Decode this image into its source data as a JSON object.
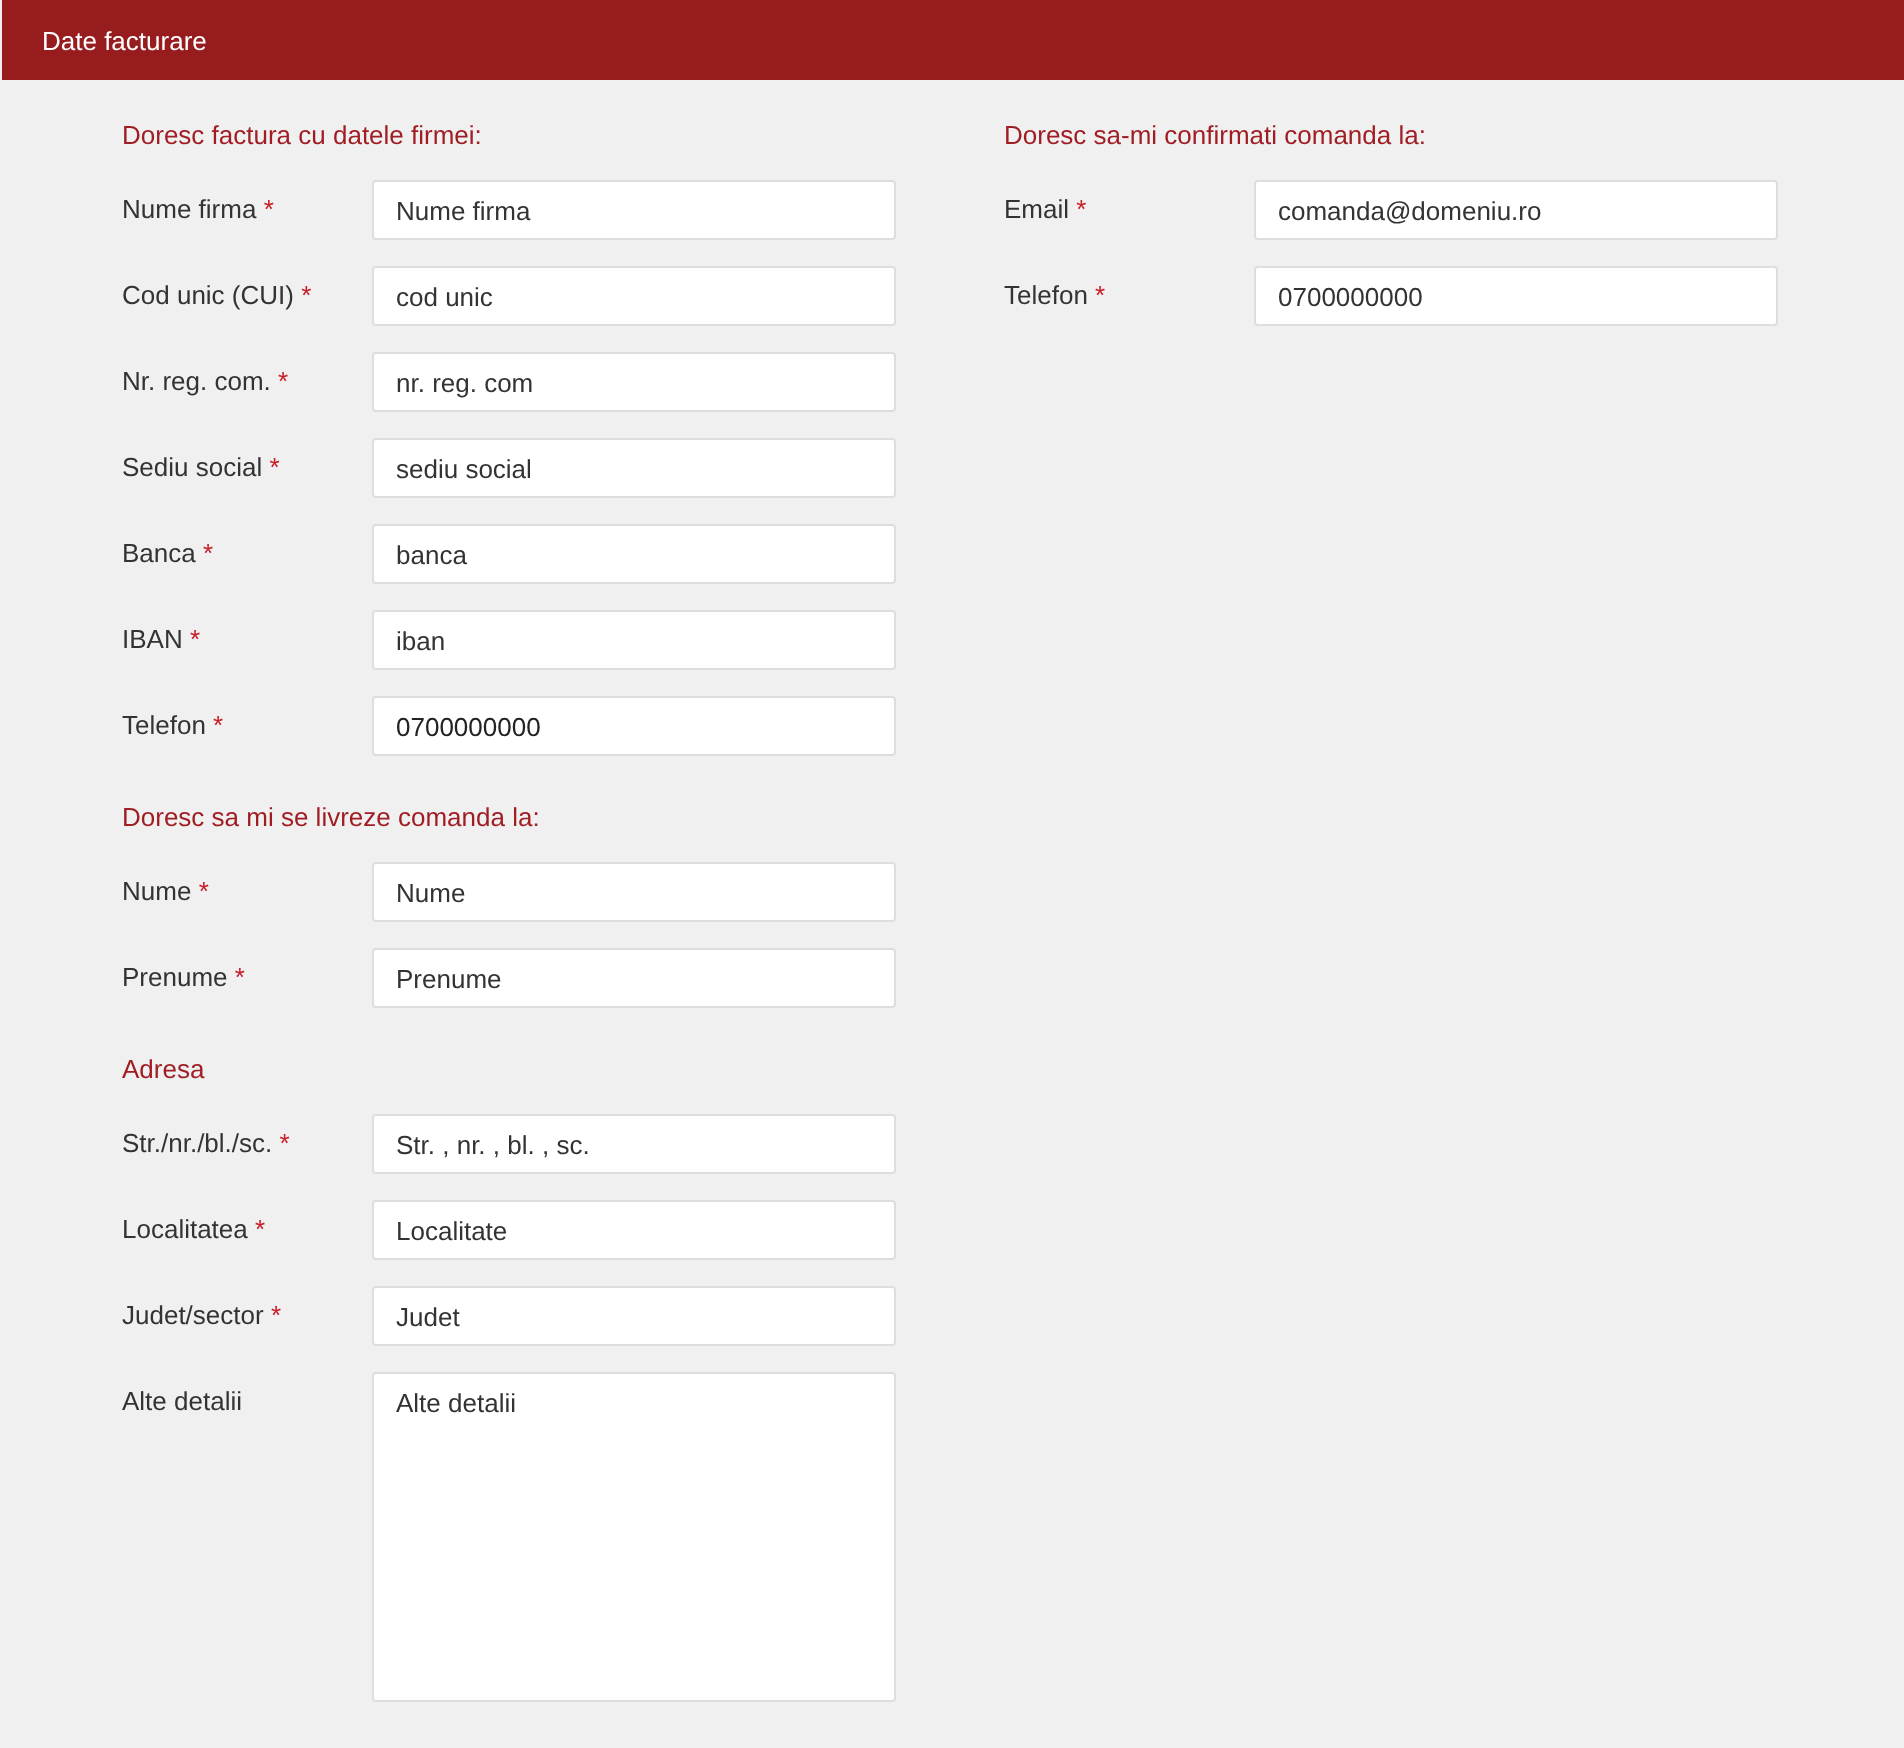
{
  "header": {
    "title": "Date facturare"
  },
  "columns": [
    {
      "sections": [
        {
          "title": "Doresc factura cu datele firmei:",
          "fields": [
            {
              "kind": "input",
              "label": "Nume firma",
              "required_mark": "*",
              "placeholder": "Nume firma"
            },
            {
              "kind": "input",
              "label": "Cod unic (CUI)",
              "required_mark": "*",
              "placeholder": "cod unic"
            },
            {
              "kind": "input",
              "label": "Nr. reg. com.",
              "required_mark": "*",
              "placeholder": "nr. reg. com"
            },
            {
              "kind": "input",
              "label": "Sediu social",
              "required_mark": "*",
              "placeholder": "sediu social"
            },
            {
              "kind": "input",
              "label": "Banca",
              "required_mark": "*",
              "placeholder": "banca"
            },
            {
              "kind": "input",
              "label": "IBAN",
              "required_mark": "*",
              "placeholder": "iban"
            },
            {
              "kind": "input",
              "label": "Telefon",
              "required_mark": "*",
              "value": "0700000000"
            }
          ]
        },
        {
          "title": "Doresc sa mi se livreze comanda la:",
          "fields": [
            {
              "kind": "input",
              "label": "Nume",
              "required_mark": "*",
              "placeholder": "Nume"
            },
            {
              "kind": "input",
              "label": "Prenume",
              "required_mark": "*",
              "placeholder": "Prenume"
            }
          ]
        },
        {
          "title": "Adresa",
          "fields": [
            {
              "kind": "input",
              "label": "Str./nr./bl./sc.",
              "required_mark": "*",
              "placeholder": "Str. , nr. , bl. , sc."
            },
            {
              "kind": "input",
              "label": "Localitatea",
              "required_mark": "*",
              "placeholder": "Localitate"
            },
            {
              "kind": "input",
              "label": "Judet/sector",
              "required_mark": "*",
              "placeholder": "Judet"
            },
            {
              "kind": "textarea",
              "label": "Alte detalii",
              "placeholder": "Alte detalii"
            }
          ]
        }
      ]
    },
    {
      "sections": [
        {
          "title": "Doresc sa-mi confirmati comanda la:",
          "fields": [
            {
              "kind": "input",
              "label": "Email",
              "required_mark": "*",
              "placeholder": "comanda@domeniu.ro"
            },
            {
              "kind": "input",
              "label": "Telefon",
              "required_mark": "*",
              "placeholder": "0700000000"
            }
          ]
        }
      ]
    }
  ]
}
